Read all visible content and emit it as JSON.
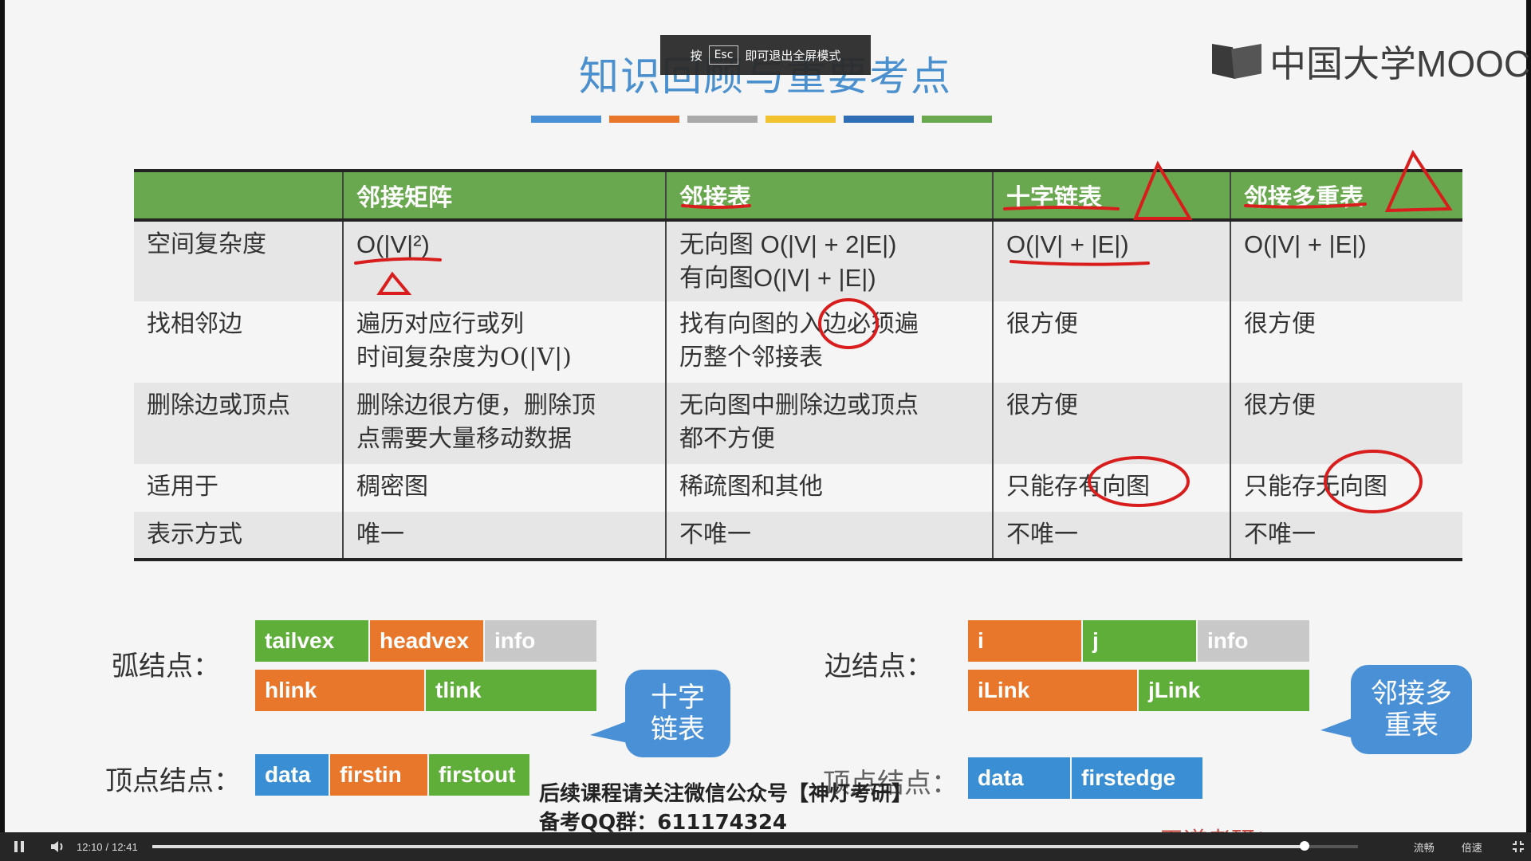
{
  "fullscreen_tip": {
    "prefix": "按",
    "key": "Esc",
    "suffix": "即可退出全屏模式"
  },
  "slide": {
    "title": "知识回顾与重要考点",
    "color_bars": [
      "#4a90d6",
      "#e8772c",
      "#a9a9a9",
      "#f2c12e",
      "#2f6db5",
      "#6aa84f"
    ],
    "logo_text": "中国大学MOOC",
    "table": {
      "headers": [
        "",
        "邻接矩阵",
        "邻接表",
        "十字链表",
        "邻接多重表"
      ],
      "rows": [
        {
          "label": "空间复杂度",
          "cells": [
            "O(|V|²)",
            "无向图 O(|V| + 2|E|)\n有向图O(|V| + |E|)",
            "O(|V| + |E|)",
            "O(|V| + |E|)"
          ]
        },
        {
          "label": "找相邻边",
          "cells": [
            "遍历对应行或列\n时间复杂度为O(|V|)",
            "找有向图的入边必须遍\n历整个邻接表",
            "很方便",
            "很方便"
          ]
        },
        {
          "label": "删除边或顶点",
          "cells": [
            "删除边很方便，删除顶\n点需要大量移动数据",
            "无向图中删除边或顶点\n都不方便",
            "很方便",
            "很方便"
          ]
        },
        {
          "label": "适用于",
          "cells": [
            "稠密图",
            "稀疏图和其他",
            "只能存有向图",
            "只能存无向图"
          ]
        },
        {
          "label": "表示方式",
          "cells": [
            "唯一",
            "不唯一",
            "不唯一",
            "不唯一"
          ]
        }
      ]
    },
    "arc_node": {
      "label": "弧结点：",
      "row1": [
        "tailvex",
        "headvex",
        "info"
      ],
      "row2": [
        "hlink",
        "tlink"
      ]
    },
    "vertex_node_left": {
      "label": "顶点结点：",
      "cells": [
        "data",
        "firstin",
        "firstout"
      ]
    },
    "bubble_left": "十字\n链表",
    "edge_node": {
      "label": "边结点：",
      "row1": [
        "i",
        "j",
        "info"
      ],
      "row2": [
        "iLink",
        "jLink"
      ]
    },
    "vertex_node_right": {
      "label": "顶点结点：",
      "cells": [
        "data",
        "firstedge"
      ]
    },
    "bubble_right": "邻接多\n重表",
    "promo_line1": "后续课程请关注微信公众号【神灯考研】",
    "promo_line2": "备考QQ群：611174324",
    "watermark": "王道考研/CSKAOYAN.COM"
  },
  "player": {
    "current_time": "12:10",
    "separator": "/",
    "duration": "12:41",
    "progress_fraction": 0.956,
    "quality_label": "流畅",
    "speed_label": "倍速"
  }
}
